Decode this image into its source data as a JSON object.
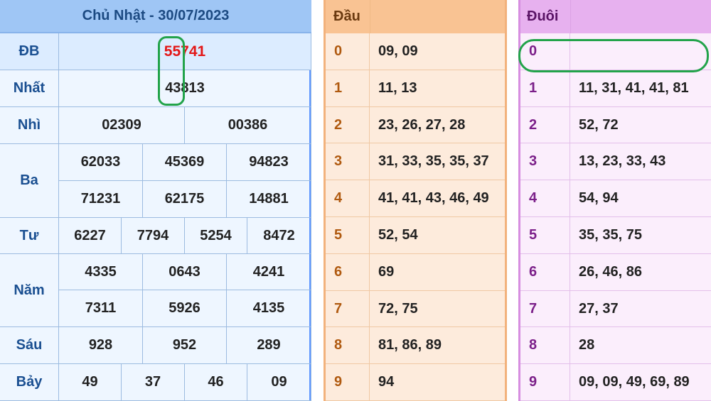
{
  "results": {
    "title": "Chủ Nhật - 30/07/2023",
    "rows": [
      {
        "label": "ĐB",
        "values": [
          "55741"
        ]
      },
      {
        "label": "Nhất",
        "values": [
          "43813"
        ]
      },
      {
        "label": "Nhì",
        "values": [
          "02309",
          "00386"
        ]
      },
      {
        "label": "Ba",
        "values": [
          "62033",
          "45369",
          "94823",
          "71231",
          "62175",
          "14881"
        ]
      },
      {
        "label": "Tư",
        "values": [
          "6227",
          "7794",
          "5254",
          "8472"
        ]
      },
      {
        "label": "Năm",
        "values": [
          "4335",
          "0643",
          "4241",
          "7311",
          "5926",
          "4135"
        ]
      },
      {
        "label": "Sáu",
        "values": [
          "928",
          "952",
          "289"
        ]
      },
      {
        "label": "Bảy",
        "values": [
          "49",
          "37",
          "46",
          "09"
        ]
      }
    ]
  },
  "dau": {
    "header": "Đầu",
    "rows": [
      {
        "key": "0",
        "value": "09, 09"
      },
      {
        "key": "1",
        "value": "11, 13"
      },
      {
        "key": "2",
        "value": "23, 26, 27, 28"
      },
      {
        "key": "3",
        "value": "31, 33, 35, 35, 37"
      },
      {
        "key": "4",
        "value": "41, 41, 43, 46, 49"
      },
      {
        "key": "5",
        "value": "52, 54"
      },
      {
        "key": "6",
        "value": "69"
      },
      {
        "key": "7",
        "value": "72, 75"
      },
      {
        "key": "8",
        "value": "81, 86, 89"
      },
      {
        "key": "9",
        "value": "94"
      }
    ]
  },
  "duoi": {
    "header": "Đuôi",
    "rows": [
      {
        "key": "0",
        "value": ""
      },
      {
        "key": "1",
        "value": "11, 31, 41, 41, 81"
      },
      {
        "key": "2",
        "value": "52, 72"
      },
      {
        "key": "3",
        "value": "13, 23, 33, 43"
      },
      {
        "key": "4",
        "value": "54, 94"
      },
      {
        "key": "5",
        "value": "35, 35, 75"
      },
      {
        "key": "6",
        "value": "26, 46, 86"
      },
      {
        "key": "7",
        "value": "27, 37"
      },
      {
        "key": "8",
        "value": "28"
      },
      {
        "key": "9",
        "value": "09, 09, 49, 69, 89"
      }
    ]
  },
  "colors": {
    "special_prize": "#e31717",
    "highlight_mark": "#22a34a"
  }
}
